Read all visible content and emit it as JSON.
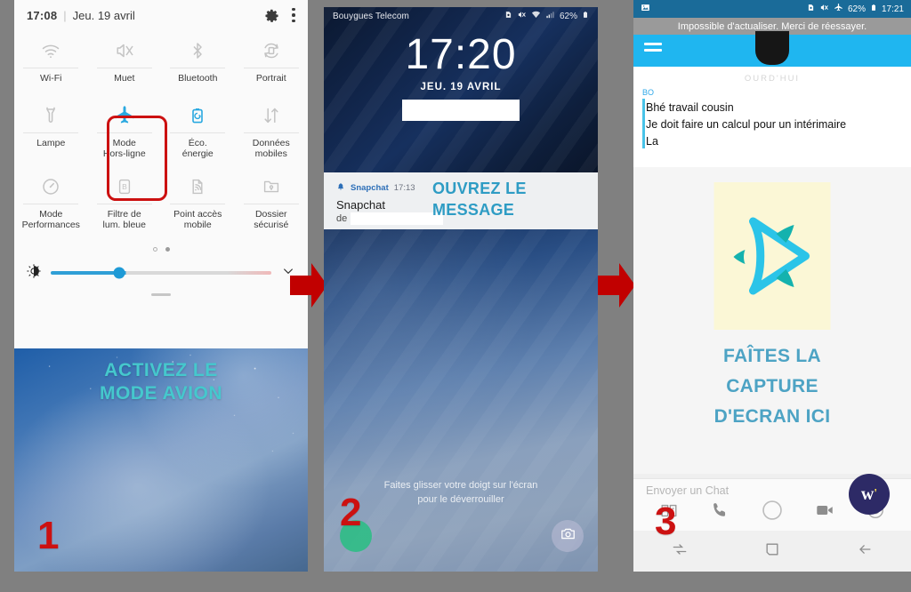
{
  "meta": {
    "accent_teal": "#45c8cd",
    "accent_blue": "#4da3c4",
    "step_red": "#cc1111",
    "highlight_red": "#cc1010",
    "snap_blue": "#1fb6f0",
    "background": "#808080"
  },
  "panel1": {
    "step_number": "1",
    "status": {
      "time": "17:08",
      "separator": "|",
      "date": "Jeu. 19 avril"
    },
    "icons": {
      "settings": "gear-icon",
      "more": "kebab-menu-icon"
    },
    "tiles": [
      {
        "label": "Wi-Fi",
        "icon": "wifi-icon",
        "state": "off"
      },
      {
        "label": "Muet",
        "icon": "mute-icon",
        "state": "off"
      },
      {
        "label": "Bluetooth",
        "icon": "bluetooth-icon",
        "state": "off"
      },
      {
        "label": "Portrait",
        "icon": "auto-rotate-icon",
        "state": "off"
      },
      {
        "label": "Lampe",
        "icon": "flashlight-icon",
        "state": "off"
      },
      {
        "label": "Mode\nHors-ligne",
        "icon": "airplane-mode-icon",
        "state": "on"
      },
      {
        "label": "Éco.\nénergie",
        "icon": "power-saving-icon",
        "state": "on"
      },
      {
        "label": "Données\nmobiles",
        "icon": "mobile-data-icon",
        "state": "off"
      },
      {
        "label": "Mode\nPerformances",
        "icon": "performance-mode-icon",
        "state": "off"
      },
      {
        "label": "Filtre de\nlum. bleue",
        "icon": "blue-light-filter-icon",
        "state": "off"
      },
      {
        "label": "Point accès\nmobile",
        "icon": "mobile-hotspot-icon",
        "state": "off"
      },
      {
        "label": "Dossier\nsécurisé",
        "icon": "secure-folder-icon",
        "state": "off"
      }
    ],
    "brightness": {
      "icon": "brightness-icon",
      "value_percent": 31,
      "expand_icon": "chevron-down-icon"
    },
    "pager": {
      "total": 2,
      "current": 2
    },
    "caption": "ACTIVEZ LE\nMODE AVION",
    "caption_line1": "ACTIVEZ LE",
    "caption_line2": "MODE AVION"
  },
  "panel2": {
    "step_number": "2",
    "status": {
      "carrier": "Bouygues Telecom",
      "battery": "62%",
      "icons": [
        "sim-icon",
        "mute-icon",
        "wifi-icon",
        "signal-icon",
        "battery-icon"
      ]
    },
    "clock": "17:20",
    "date": "JEU. 19 AVRIL",
    "notification": {
      "app": "Snapchat",
      "time": "17:13",
      "title": "Snapchat",
      "subtitle_prefix": "de",
      "bell_icon": "bell-icon"
    },
    "caption_line1": "OUVREZ LE",
    "caption_line2": "MESSAGE",
    "unlock_hint_line1": "Faites glisser votre doigt sur l'écran",
    "unlock_hint_line2": "pour le déverrouiller",
    "shortcuts": [
      {
        "name": "phone-shortcut",
        "icon": "phone-icon"
      },
      {
        "name": "camera-shortcut",
        "icon": "camera-icon"
      }
    ]
  },
  "panel3": {
    "step_number": "3",
    "status": {
      "left_icon": "screenshot-icon",
      "battery": "62%",
      "time": "17:21",
      "icons": [
        "sim-icon",
        "mute-icon",
        "airplane-icon",
        "battery-icon"
      ]
    },
    "banner": "Impossible d'actualiser. Merci de réessayer.",
    "menu_icon": "hamburger-menu-icon",
    "avatar": "avatar",
    "today_label": "OURD'HUI",
    "sender": "BO",
    "message_lines": [
      "Bhé travail cousin",
      "Je doit faire un calcul pour un intérimaire",
      "La"
    ],
    "logo": "snapchat-logo",
    "caption_line1": "FAÎTES LA",
    "caption_line2": "CAPTURE",
    "caption_line3": "D'ECRAN ICI",
    "chat_placeholder": "Envoyer un Chat",
    "chat_icons": [
      {
        "name": "gallery-icon"
      },
      {
        "name": "call-icon"
      },
      {
        "name": "camera-shutter-icon"
      },
      {
        "name": "video-call-icon"
      },
      {
        "name": "sticker-icon"
      }
    ],
    "nav_icons": [
      {
        "name": "recents-icon"
      },
      {
        "name": "home-icon"
      },
      {
        "name": "back-icon"
      }
    ],
    "watermark": {
      "letter": "w",
      "mark": "'"
    }
  },
  "arrows": [
    {
      "name": "arrow-step1-to-step2",
      "direction": "right"
    },
    {
      "name": "arrow-step2-to-step3",
      "direction": "right"
    }
  ]
}
